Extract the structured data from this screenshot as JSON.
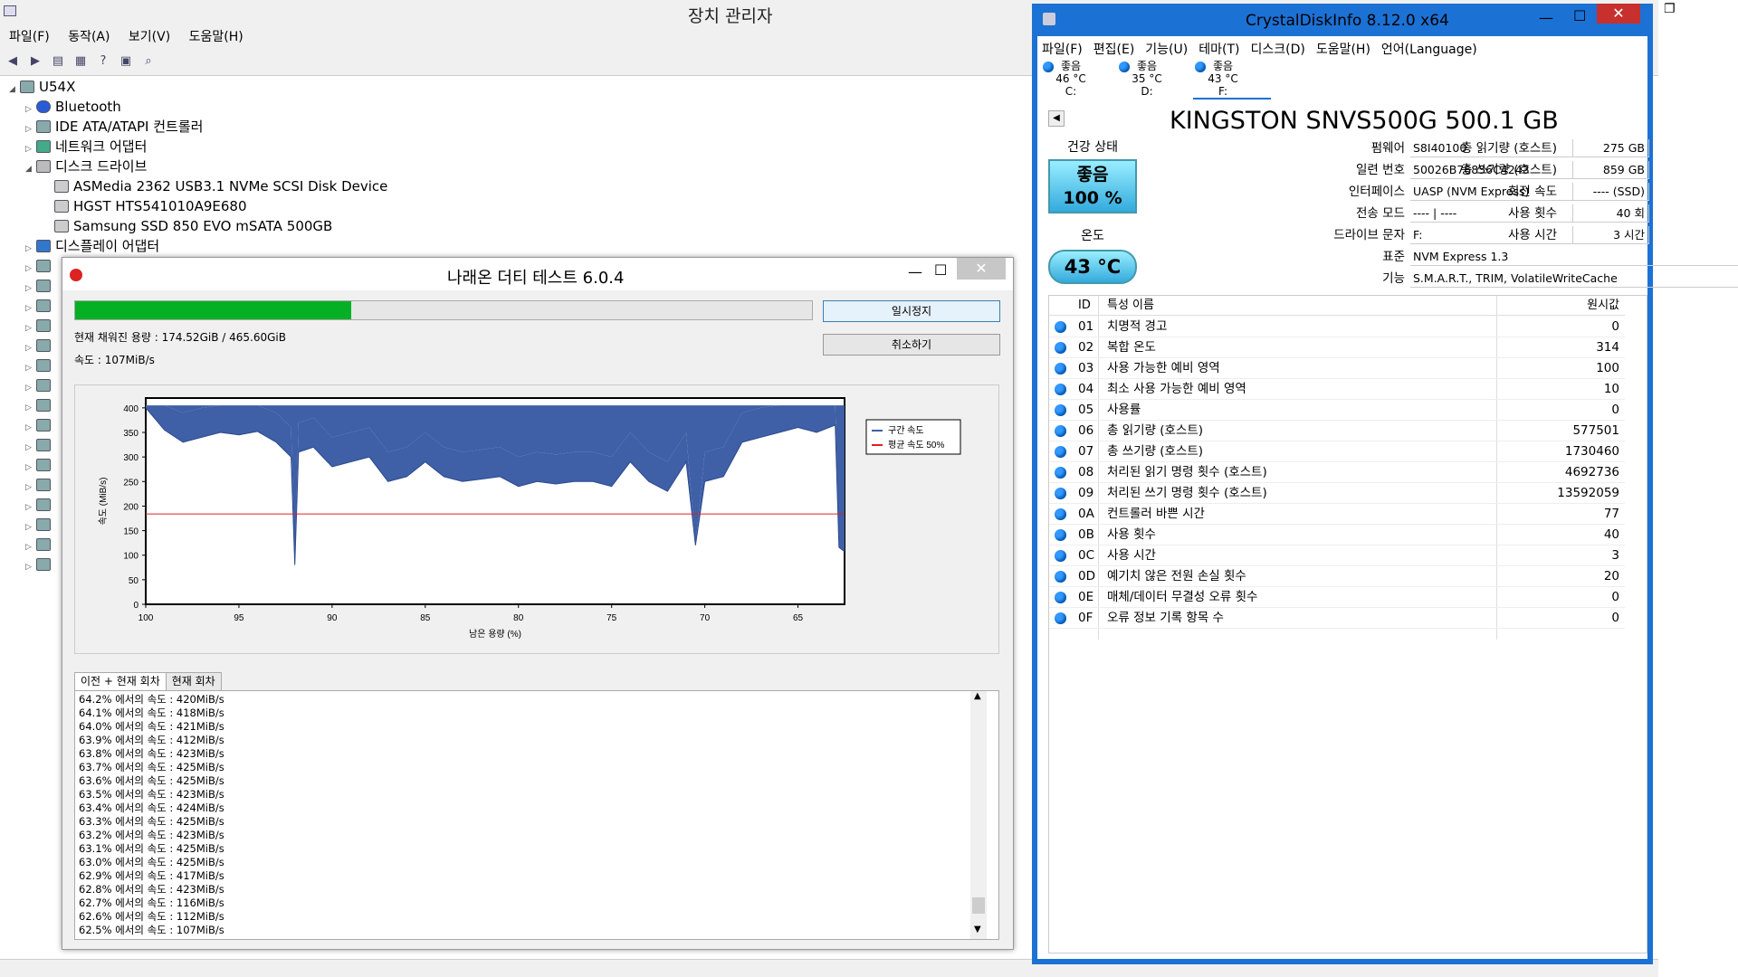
{
  "device_manager": {
    "title": "장치 관리자",
    "menu": [
      "파일(F)",
      "동작(A)",
      "보기(V)",
      "도움말(H)"
    ],
    "tree": {
      "root": "U54X",
      "items": [
        {
          "label": "Bluetooth",
          "expanded": false
        },
        {
          "label": "IDE ATA/ATAPI 컨트롤러",
          "expanded": false
        },
        {
          "label": "네트워크 어댑터",
          "expanded": false
        },
        {
          "label": "디스크 드라이브",
          "expanded": true,
          "children": [
            "ASMedia 2362 USB3.1 NVMe SCSI Disk Device",
            "HGST HTS541010A9E680",
            "Samsung SSD 850 EVO mSATA 500GB"
          ]
        },
        {
          "label": "디스플레이 어댑터",
          "expanded": false
        }
      ]
    }
  },
  "naraeon": {
    "title": "나래온 더티 테스트 6.0.4",
    "progress_fraction": 0.3748,
    "filled_label": "현재 채워진 용량 : 174.52GiB / 465.60GiB",
    "speed_label": "속도 : 107MiB/s",
    "pause_button": "일시정지",
    "cancel_button": "취소하기",
    "tabs": [
      "이전 + 현재 회차",
      "현재 회차"
    ],
    "log": [
      "64.2% 에서의 속도 : 420MiB/s",
      "64.1% 에서의 속도 : 418MiB/s",
      "64.0% 에서의 속도 : 421MiB/s",
      "63.9% 에서의 속도 : 412MiB/s",
      "63.8% 에서의 속도 : 423MiB/s",
      "63.7% 에서의 속도 : 425MiB/s",
      "63.6% 에서의 속도 : 425MiB/s",
      "63.5% 에서의 속도 : 423MiB/s",
      "63.4% 에서의 속도 : 424MiB/s",
      "63.3% 에서의 속도 : 425MiB/s",
      "63.2% 에서의 속도 : 423MiB/s",
      "63.1% 에서의 속도 : 425MiB/s",
      "63.0% 에서의 속도 : 425MiB/s",
      "62.9% 에서의 속도 : 417MiB/s",
      "62.8% 에서의 속도 : 423MiB/s",
      "62.7% 에서의 속도 : 116MiB/s",
      "62.6% 에서의 속도 : 112MiB/s",
      "62.5% 에서의 속도 : 107MiB/s"
    ],
    "chart_data": {
      "type": "line",
      "xlabel": "남은 용량 (%)",
      "ylabel": "속도 (MiB/s)",
      "xlim": [
        100,
        62.5
      ],
      "ylim": [
        0,
        420
      ],
      "xticks": [
        100,
        95,
        90,
        85,
        80,
        75,
        70,
        65
      ],
      "yticks": [
        0,
        50,
        100,
        150,
        200,
        250,
        300,
        350,
        400
      ],
      "legend": "top-right",
      "series": [
        {
          "name": "구간 속도",
          "color": "#3f5fa6",
          "x": [
            100,
            99,
            98,
            97,
            96,
            95,
            94,
            93,
            92.2,
            92,
            91.8,
            91,
            90,
            89,
            88,
            87,
            86,
            85,
            84,
            83,
            82,
            81,
            80,
            79,
            78,
            77,
            76,
            75,
            74,
            73,
            72,
            71,
            70.5,
            70,
            69,
            68,
            67,
            66,
            65,
            64,
            63,
            62.8,
            62.5
          ],
          "y": [
            400,
            355,
            330,
            340,
            350,
            345,
            352,
            330,
            300,
            80,
            310,
            320,
            280,
            290,
            300,
            250,
            260,
            290,
            260,
            250,
            255,
            260,
            240,
            250,
            245,
            250,
            250,
            240,
            290,
            250,
            230,
            290,
            120,
            250,
            260,
            330,
            340,
            350,
            360,
            350,
            365,
            116,
            107
          ]
        },
        {
          "name": "평균 속도 50%",
          "color": "#e02020",
          "x": [
            100,
            62.5
          ],
          "y": [
            184,
            184
          ]
        }
      ]
    }
  },
  "crystal": {
    "title": "CrystalDiskInfo 8.12.0 x64",
    "menu": [
      "파일(F)",
      "편집(E)",
      "기능(U)",
      "테마(T)",
      "디스크(D)",
      "도움말(H)",
      "언어(Language)"
    ],
    "drives": [
      {
        "status": "좋음",
        "temp": "46 °C",
        "letter": "C:"
      },
      {
        "status": "좋음",
        "temp": "35 °C",
        "letter": "D:"
      },
      {
        "status": "좋음",
        "temp": "43 °C",
        "letter": "F:"
      }
    ],
    "model": "KINGSTON SNVS500G 500.1 GB",
    "health_label": "건강 상태",
    "health_status": "좋음",
    "health_pct": "100 %",
    "temp_label": "온도",
    "temp_value": "43 °C",
    "fields": [
      {
        "k": "펌웨어",
        "v": "S8I40100"
      },
      {
        "k": "일련 번호",
        "v": "50026B76856C4243"
      },
      {
        "k": "인터페이스",
        "v": "UASP (NVM Express)"
      },
      {
        "k": "전송 모드",
        "v": "---- | ----"
      },
      {
        "k": "드라이브 문자",
        "v": "F:"
      },
      {
        "k": "표준",
        "v": "NVM Express 1.3"
      },
      {
        "k": "기능",
        "v": "S.M.A.R.T., TRIM, VolatileWriteCache"
      }
    ],
    "right_fields": [
      {
        "k": "총 읽기량 (호스트)",
        "v": "275 GB"
      },
      {
        "k": "총 쓰기량 (호스트)",
        "v": "859 GB"
      },
      {
        "k": "회전 속도",
        "v": "---- (SSD)"
      },
      {
        "k": "사용 횟수",
        "v": "40 회"
      },
      {
        "k": "사용 시간",
        "v": "3 시간"
      }
    ],
    "smart_header": {
      "id": "ID",
      "name": "특성 이름",
      "raw": "원시값"
    },
    "smart": [
      {
        "id": "01",
        "name": "치명적 경고",
        "raw": "0"
      },
      {
        "id": "02",
        "name": "복합 온도",
        "raw": "314"
      },
      {
        "id": "03",
        "name": "사용 가능한 예비 영역",
        "raw": "100"
      },
      {
        "id": "04",
        "name": "최소 사용 가능한 예비 영역",
        "raw": "10"
      },
      {
        "id": "05",
        "name": "사용률",
        "raw": "0"
      },
      {
        "id": "06",
        "name": "총 읽기량 (호스트)",
        "raw": "577501"
      },
      {
        "id": "07",
        "name": "총 쓰기량 (호스트)",
        "raw": "1730460"
      },
      {
        "id": "08",
        "name": "처리된 읽기 명령 횟수 (호스트)",
        "raw": "4692736"
      },
      {
        "id": "09",
        "name": "처리된 쓰기 명령 횟수 (호스트)",
        "raw": "13592059"
      },
      {
        "id": "0A",
        "name": "컨트롤러 바쁜 시간",
        "raw": "77"
      },
      {
        "id": "0B",
        "name": "사용 횟수",
        "raw": "40"
      },
      {
        "id": "0C",
        "name": "사용 시간",
        "raw": "3"
      },
      {
        "id": "0D",
        "name": "예기치 않은 전원 손실 횟수",
        "raw": "20"
      },
      {
        "id": "0E",
        "name": "매체/데이터 무결성 오류 횟수",
        "raw": "0"
      },
      {
        "id": "0F",
        "name": "오류 정보 기록 항목 수",
        "raw": "0"
      }
    ]
  }
}
